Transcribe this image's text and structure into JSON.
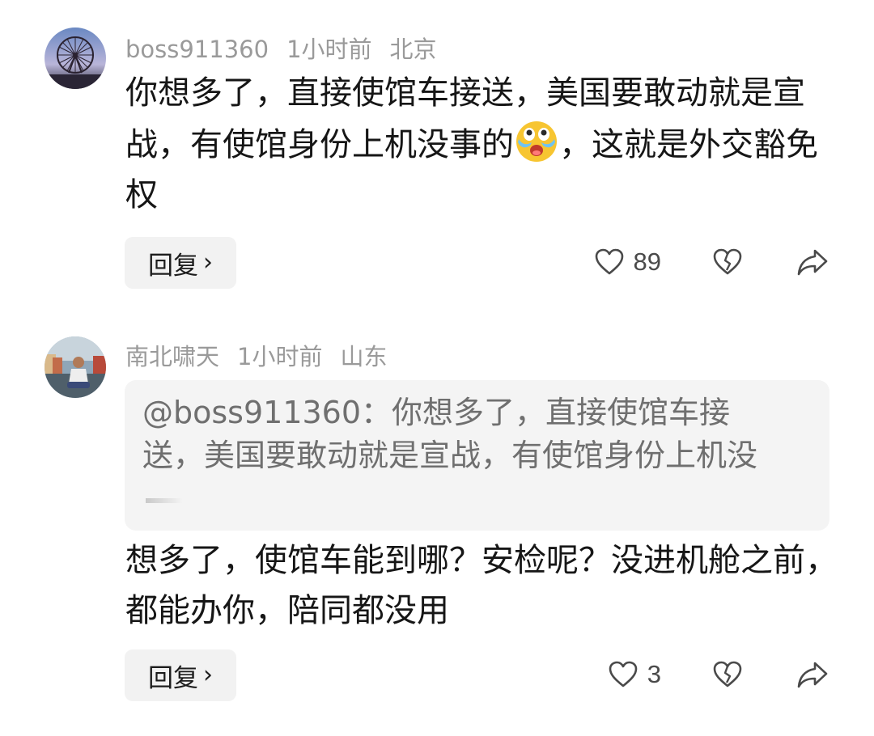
{
  "comments": [
    {
      "username": "boss911360",
      "time": "1小时前",
      "location": "北京",
      "text_part1": "你想多了，直接使馆车接送，美国要敢动就是宣战，有使馆身份上机没事的",
      "text_part2": "，这就是外交豁免权",
      "emoji": "crying-emoji",
      "reply_label": "回复",
      "likes": "89"
    },
    {
      "username": "南北啸天",
      "time": "1小时前",
      "location": "山东",
      "quote": "@boss911360：你想多了，直接使馆车接送，美国要敢动就是宣战，有使馆身份上机没",
      "text": "想多了，使馆车能到哪？安检呢？没进机舱之前，都能办你，陪同都没用",
      "reply_label": "回复",
      "likes": "3"
    }
  ],
  "colors": {
    "meta": "#9a9a9a",
    "text": "#161616",
    "reply_bg": "#f2f2f2",
    "quote_bg": "#f4f4f4"
  }
}
